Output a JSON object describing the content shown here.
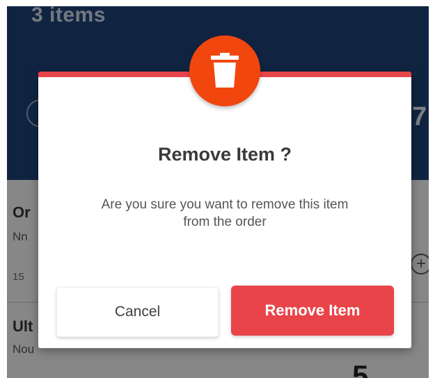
{
  "background": {
    "header": {
      "item_count": "3 items",
      "total_partial": "7"
    },
    "rows": [
      {
        "name": "Or",
        "subtitle": "Nn",
        "price": "15"
      },
      {
        "name": "Ult",
        "subtitle": "Nou",
        "quantity": "5"
      }
    ],
    "plus_symbol": "+"
  },
  "dialog": {
    "icon": "trash-icon",
    "title": "Remove Item ?",
    "message_line1": "Are you sure you want to remove this item",
    "message_line2": "from the order",
    "cancel_label": "Cancel",
    "confirm_label": "Remove Item"
  },
  "colors": {
    "accent": "#e8444a",
    "icon_badge": "#f2460f",
    "header_bg": "#1c3f72"
  }
}
